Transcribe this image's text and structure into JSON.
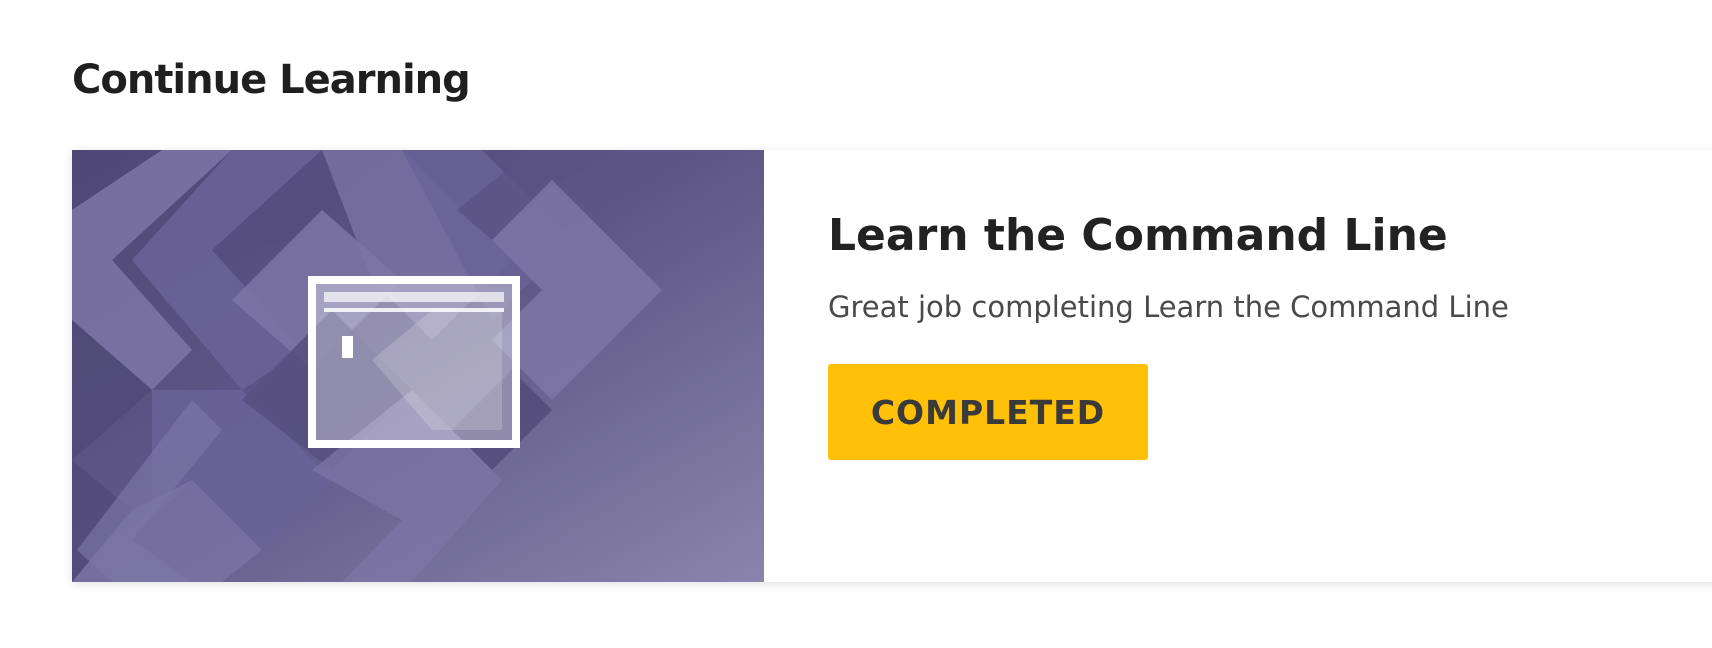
{
  "section": {
    "title": "Continue Learning"
  },
  "course": {
    "title": "Learn the Command Line",
    "message": "Great job completing Learn the Command Line",
    "status_label": "COMPLETED",
    "icon": "terminal-window-icon"
  },
  "colors": {
    "art_base": "#5d5686",
    "art_chevron_light": "#7d76a6",
    "art_chevron_mid": "#6a6396",
    "art_chevron_dark": "#514a78",
    "status_button": "#ffc107",
    "status_text": "#3a3a3a"
  }
}
